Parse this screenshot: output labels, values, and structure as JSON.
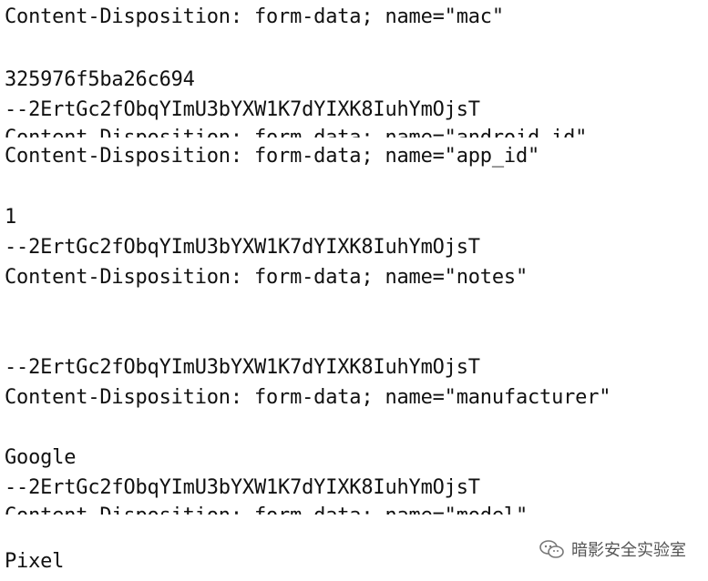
{
  "lines": [
    "Content-Disposition: form-data; name=\"mac\"",
    "325976f5ba26c694",
    "--2ErtGc2fObqYImU3bYXW1K7dYIXK8IuhYmOjsT",
    "Content-Disposition: form-data; name=\"app_id\"",
    "1",
    "--2ErtGc2fObqYImU3bYXW1K7dYIXK8IuhYmOjsT",
    "Content-Disposition: form-data; name=\"notes\"",
    "--2ErtGc2fObqYImU3bYXW1K7dYIXK8IuhYmOjsT",
    "Content-Disposition: form-data; name=\"manufacturer\"",
    "Google",
    "--2ErtGc2fObqYImU3bYXW1K7dYIXK8IuhYmOjsT",
    "Pixel"
  ],
  "partial_lines": [
    "Content-Disposition: form-data; name=\"android_id\"",
    "Content-Disposition: form-data; name=\"model\""
  ],
  "watermark": {
    "icon": "wechat-icon",
    "text": "暗影安全实验室"
  }
}
